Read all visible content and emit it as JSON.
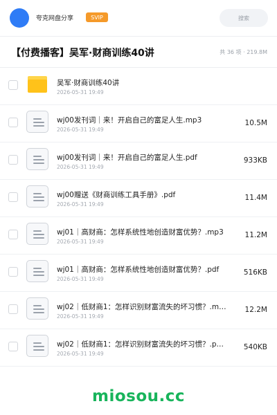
{
  "header": {
    "share_name": "夸克网盘分享",
    "badge": "SVIP",
    "search_placeholder": "搜索"
  },
  "folder": {
    "title": "【付费播客】吴军·财商训练40讲",
    "meta": "共 36 项 · 219.8M"
  },
  "items": [
    {
      "type": "folder",
      "name": "吴军·财商训练40讲",
      "date": "2026-05-31 19:49",
      "size": ""
    },
    {
      "type": "file",
      "name": "wj00发刊词｜来！开启自己的富足人生.mp3",
      "date": "2026-05-31 19:49",
      "size": "10.5M"
    },
    {
      "type": "file",
      "name": "wj00发刊词｜来！开启自己的富足人生.pdf",
      "date": "2026-05-31 19:49",
      "size": "933KB"
    },
    {
      "type": "file",
      "name": "wj00赠送《财商训练工具手册》.pdf",
      "date": "2026-05-31 19:49",
      "size": "11.4M"
    },
    {
      "type": "file",
      "name": "wj01｜高财商：怎样系统性地创造财富优势？.mp3",
      "date": "2026-05-31 19:49",
      "size": "11.2M"
    },
    {
      "type": "file",
      "name": "wj01｜高财商：怎样系统性地创造财富优势？.pdf",
      "date": "2026-05-31 19:49",
      "size": "516KB"
    },
    {
      "type": "file",
      "name": "wj02｜低财商1：怎样识别财富流失的坏习惯？.m…",
      "date": "2026-05-31 19:49",
      "size": "12.2M"
    },
    {
      "type": "file",
      "name": "wj02｜低财商1：怎样识别财富流失的坏习惯？.p…",
      "date": "2026-05-31 19:49",
      "size": "540KB"
    }
  ],
  "watermark": "miosou.cc",
  "colors": {
    "accent": "#2f7cf6",
    "svip": "#f59a2a",
    "folder": "#ffc21a",
    "watermark": "#18b45b"
  }
}
